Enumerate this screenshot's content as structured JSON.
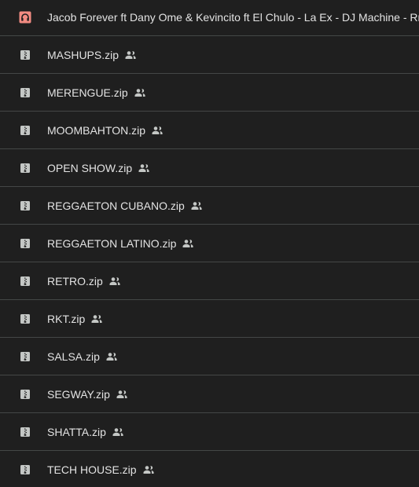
{
  "files": [
    {
      "name": "Jacob Forever ft Dany Ome & Kevincito ft El Chulo - La Ex - DJ Machine - Rmx",
      "icon": "audio-file-icon",
      "icon_color": "#f28b82",
      "shared": false
    },
    {
      "name": "MASHUPS.zip",
      "icon": "zip-file-icon",
      "icon_color": "#c4c7c5",
      "shared": true
    },
    {
      "name": "MERENGUE.zip",
      "icon": "zip-file-icon",
      "icon_color": "#c4c7c5",
      "shared": true
    },
    {
      "name": "MOOMBAHTON.zip",
      "icon": "zip-file-icon",
      "icon_color": "#c4c7c5",
      "shared": true
    },
    {
      "name": "OPEN SHOW.zip",
      "icon": "zip-file-icon",
      "icon_color": "#c4c7c5",
      "shared": true
    },
    {
      "name": "REGGAETON CUBANO.zip",
      "icon": "zip-file-icon",
      "icon_color": "#c4c7c5",
      "shared": true
    },
    {
      "name": "REGGAETON LATINO.zip",
      "icon": "zip-file-icon",
      "icon_color": "#c4c7c5",
      "shared": true
    },
    {
      "name": "RETRO.zip",
      "icon": "zip-file-icon",
      "icon_color": "#c4c7c5",
      "shared": true
    },
    {
      "name": "RKT.zip",
      "icon": "zip-file-icon",
      "icon_color": "#c4c7c5",
      "shared": true
    },
    {
      "name": "SALSA.zip",
      "icon": "zip-file-icon",
      "icon_color": "#c4c7c5",
      "shared": true
    },
    {
      "name": "SEGWAY.zip",
      "icon": "zip-file-icon",
      "icon_color": "#c4c7c5",
      "shared": true
    },
    {
      "name": "SHATTA.zip",
      "icon": "zip-file-icon",
      "icon_color": "#c4c7c5",
      "shared": true
    },
    {
      "name": "TECH HOUSE.zip",
      "icon": "zip-file-icon",
      "icon_color": "#c4c7c5",
      "shared": true
    }
  ],
  "shared_icon": "people-shared-icon",
  "colors": {
    "background": "#1f1f1f",
    "divider": "#444746",
    "text": "#e3e3e3",
    "muted_icon": "#c4c7c5",
    "audio_icon_bg": "#f28b82"
  }
}
